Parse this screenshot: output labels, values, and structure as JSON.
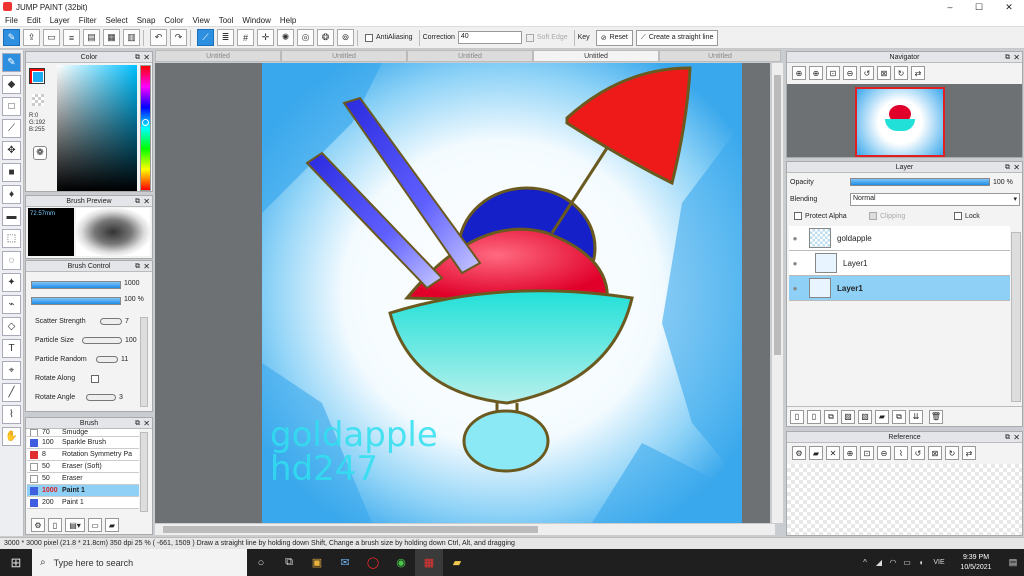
{
  "window": {
    "title": "JUMP PAINT (32bit)",
    "controls": [
      "–",
      "☐",
      "✕"
    ]
  },
  "menu": [
    "File",
    "Edit",
    "Layer",
    "Filter",
    "Select",
    "Snap",
    "Color",
    "View",
    "Tool",
    "Window",
    "Help"
  ],
  "toolbar": {
    "antialiasing_label": "AntiAliasing",
    "correction_label": "Correction",
    "correction_value": "40",
    "soft_edge_label": "Soft Edge",
    "key_label": "Key",
    "reset_label": "Reset",
    "straight_line_label": "Create a straight line"
  },
  "color_panel": {
    "title": "Color",
    "readout": [
      "R:0",
      "G:192",
      "B:255"
    ],
    "fg_color": "#1eaaf0",
    "bg_color": "#ff0000"
  },
  "brush_preview": {
    "title": "Brush Preview",
    "size": "72.57mm"
  },
  "brush_control": {
    "title": "Brush Control",
    "size_value": "1000",
    "opacity_value": "100 %",
    "rows": [
      {
        "label": "Scatter Strength",
        "value": "7"
      },
      {
        "label": "Particle Size",
        "value": "100"
      },
      {
        "label": "Particle Random",
        "value": "11"
      },
      {
        "label": "Rotate Along",
        "value": ""
      },
      {
        "label": "Rotate Angle",
        "value": "3"
      }
    ]
  },
  "brush_list": {
    "title": "Brush",
    "items": [
      {
        "size": "70",
        "name": "Smudge",
        "color": "#ffffff"
      },
      {
        "size": "100",
        "name": "Sparkle Brush",
        "color": "#3f5fe0"
      },
      {
        "size": "8",
        "name": "Rotation Symmetry Pa",
        "color": "#e03030"
      },
      {
        "size": "50",
        "name": "Eraser (Soft)",
        "color": "#ffffff"
      },
      {
        "size": "50",
        "name": "Eraser",
        "color": "#ffffff"
      },
      {
        "size": "1000",
        "name": "Paint 1",
        "color": "#3f5fe0",
        "selected": true
      },
      {
        "size": "200",
        "name": "Paint 1",
        "color": "#3f5fe0"
      }
    ]
  },
  "tabs": [
    "Untitled",
    "Untitled",
    "Untitled",
    "Untitled",
    "Untitled"
  ],
  "canvas": {
    "watermark_line1": "goldapple",
    "watermark_line2": "hd247"
  },
  "navigator": {
    "title": "Navigator"
  },
  "layer_panel": {
    "title": "Layer",
    "opacity_label": "Opacity",
    "opacity_value": "100 %",
    "blending_label": "Blending",
    "blending_value": "Normal",
    "protect_alpha_label": "Protect Alpha",
    "clipping_label": "Clipping",
    "lock_label": "Lock",
    "layers": [
      {
        "name": "goldapple",
        "selected": false
      },
      {
        "name": "Layer1",
        "selected": false
      },
      {
        "name": "Layer1",
        "selected": true
      }
    ]
  },
  "reference": {
    "title": "Reference"
  },
  "status": {
    "text": "3000 * 3000 pixel   (21.8 * 21.8cm)   350 dpi   25 %   ( -661, 1509 )   Draw a straight line by holding down Shift, Change a brush size by holding down Ctrl, Alt, and dragging"
  },
  "taskbar": {
    "search_placeholder": "Type here to search",
    "lang": "VIE",
    "time": "9:39 PM",
    "date": "10/5/2021"
  }
}
